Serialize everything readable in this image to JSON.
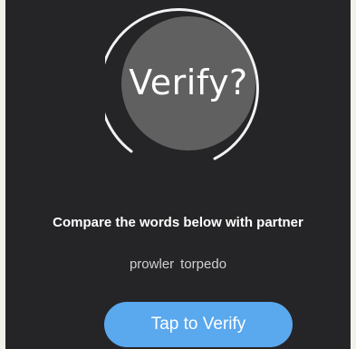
{
  "verify_title": "Verify?",
  "instruction": "Compare the words below with partner",
  "words": [
    "prowler",
    "torpedo"
  ],
  "verify_button_label": "Tap to Verify",
  "colors": {
    "background": "#252527",
    "circle_fill": "#616060",
    "ring": "#f2f2f2",
    "button": "#5aa8ee",
    "text": "#ffffff"
  }
}
